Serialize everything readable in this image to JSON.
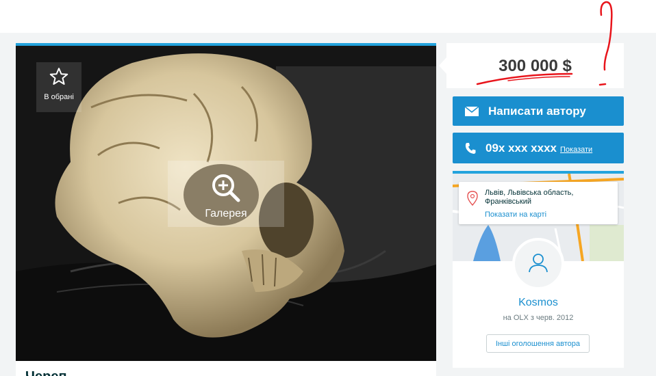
{
  "gallery": {
    "favorite_label": "В обрані",
    "zoom_label": "Галерея"
  },
  "listing": {
    "title": "Череп"
  },
  "price": {
    "value": "300 000 $"
  },
  "actions": {
    "message_label": "Написати автору",
    "phone_masked": "09x xxx xxxx",
    "show_phone_label": "Показати"
  },
  "seller": {
    "location": "Львів, Львівська область, Франківський",
    "map_link": "Показати на карті",
    "name": "Kosmos",
    "since": "на OLX з черв. 2012",
    "other_ads_label": "Інші оголошення автора"
  },
  "colors": {
    "accent": "#23a3dd",
    "button": "#1a8fcf",
    "annotation": "#e8141b"
  },
  "icons": [
    "star-icon",
    "zoom-icon",
    "envelope-icon",
    "phone-icon",
    "location-pin-icon",
    "user-icon"
  ]
}
